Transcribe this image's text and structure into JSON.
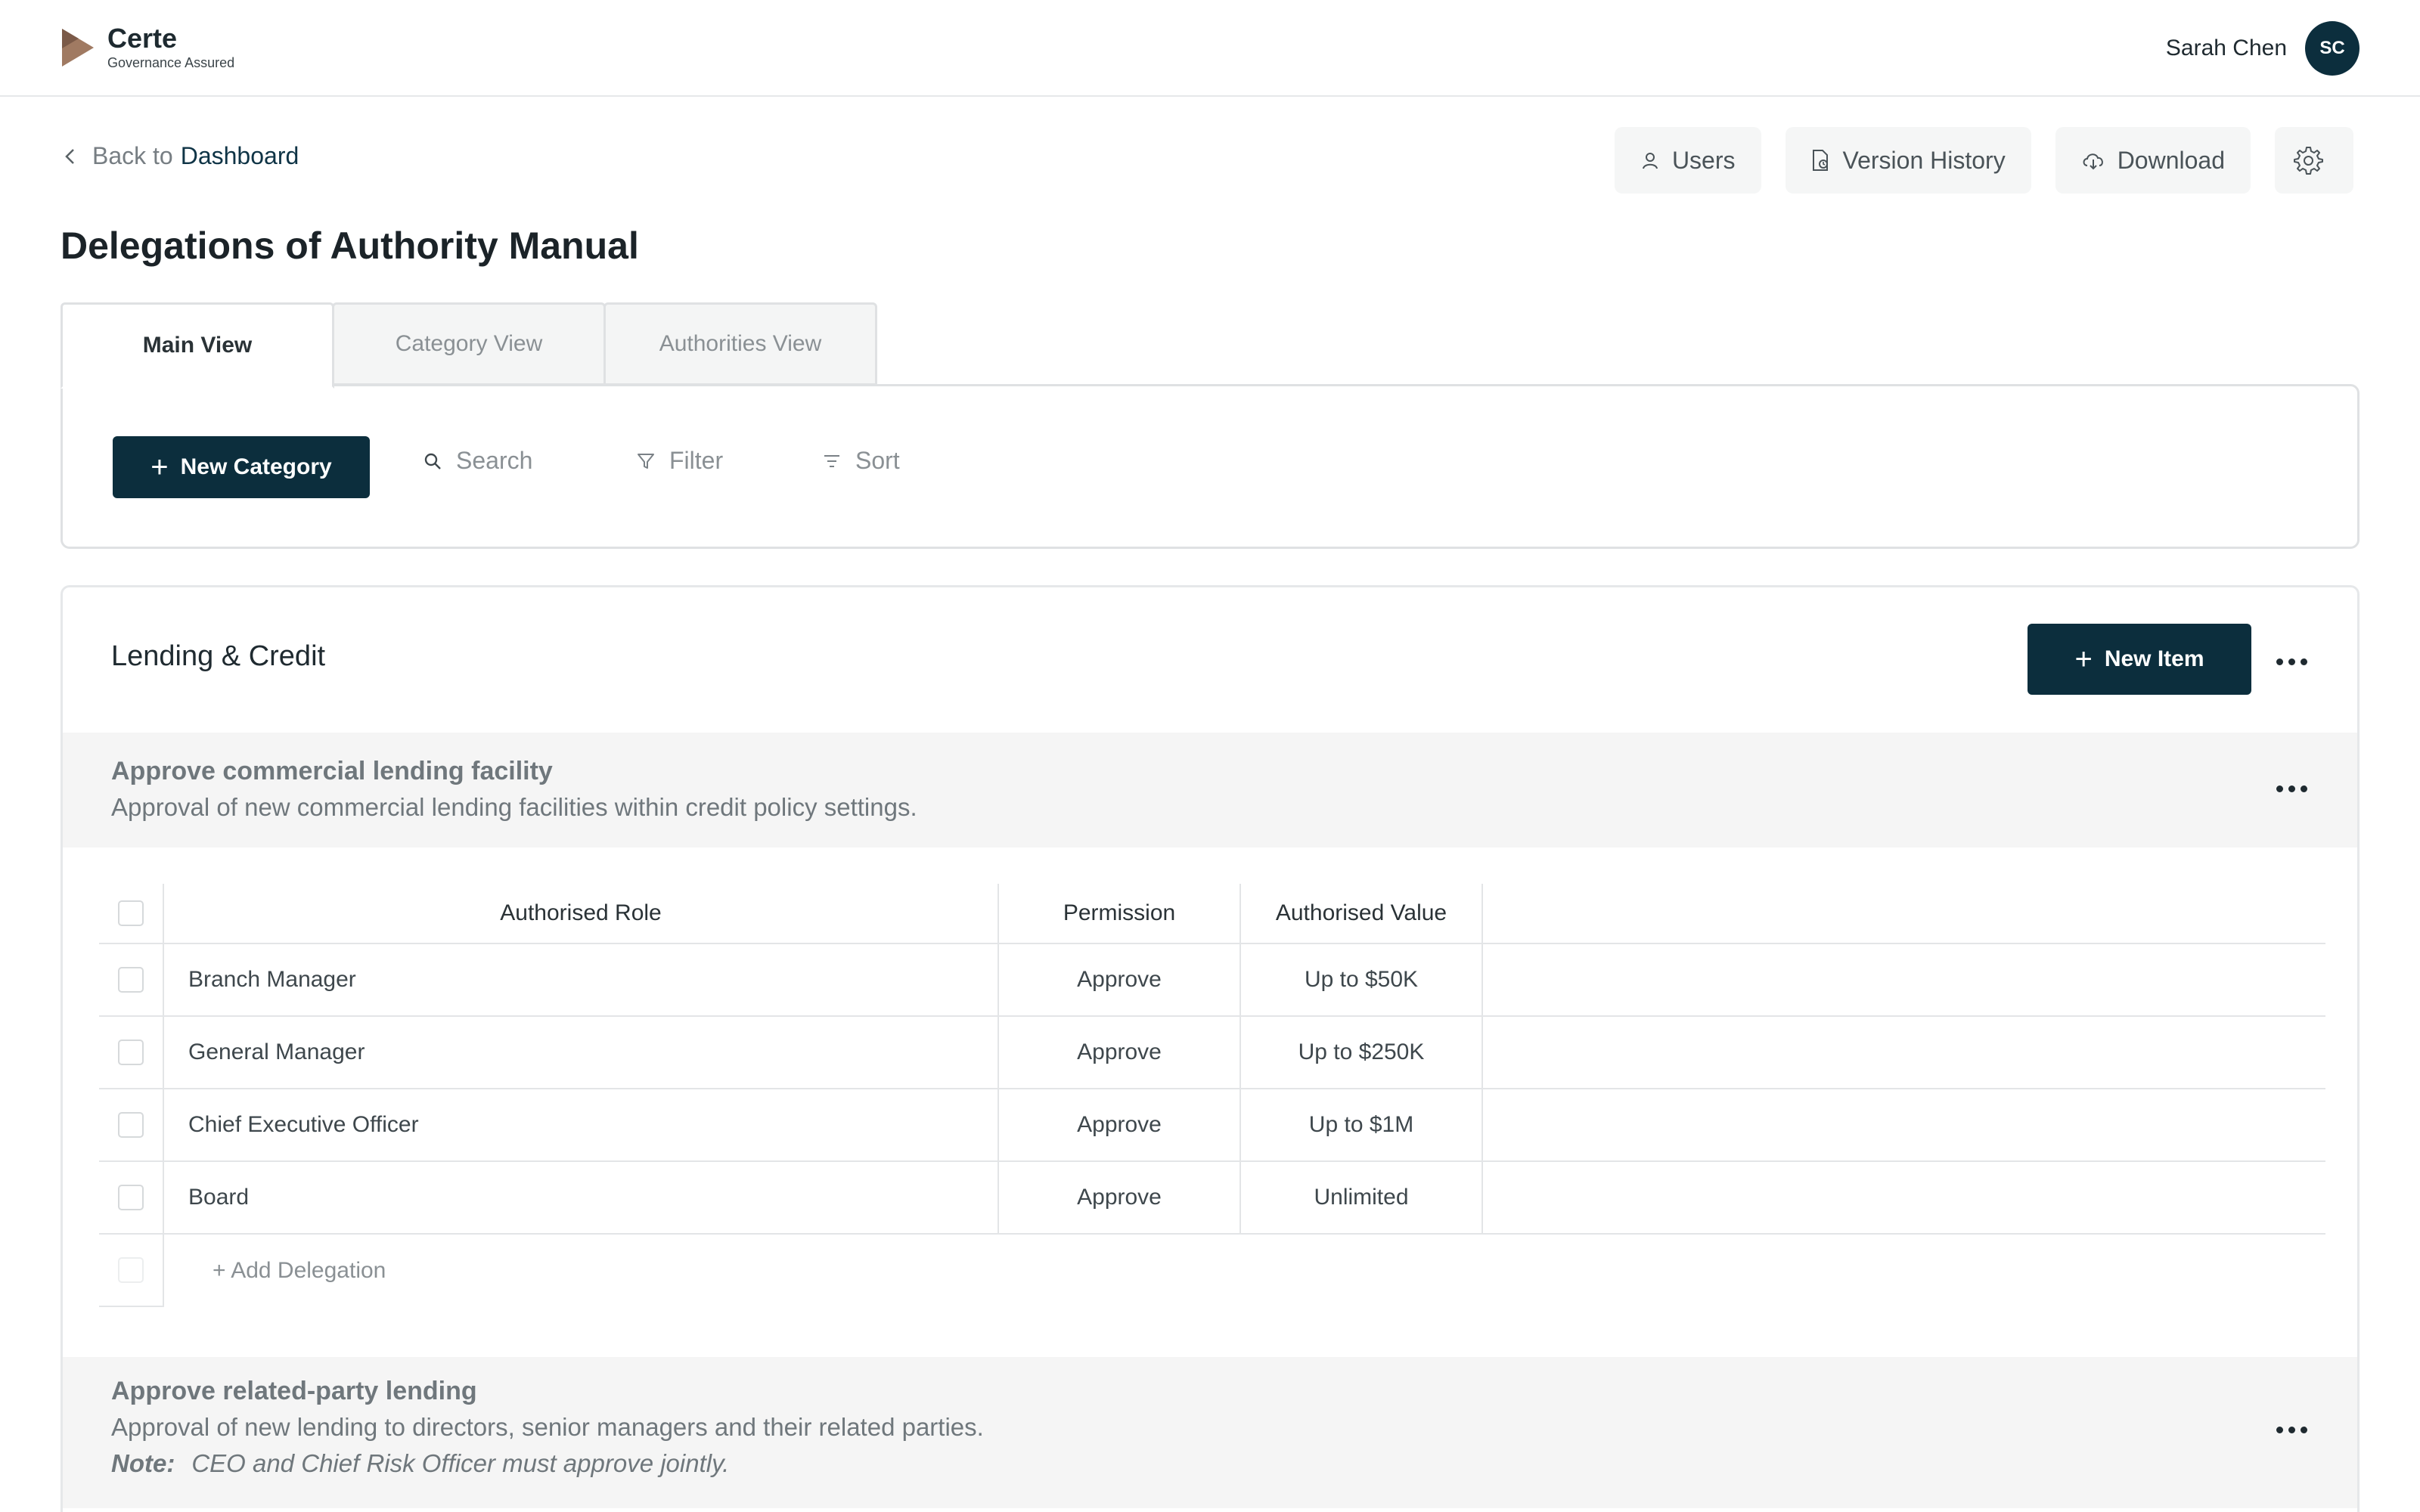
{
  "brand": {
    "name": "Certe",
    "tagline": "Governance Assured"
  },
  "user": {
    "name": "Sarah Chen",
    "initials": "SC"
  },
  "nav": {
    "back_prefix": "Back to",
    "back_target": "Dashboard"
  },
  "actions": {
    "users": "Users",
    "version_history": "Version History",
    "download": "Download"
  },
  "page": {
    "title": "Delegations of Authority Manual"
  },
  "tabs": [
    {
      "label": "Main View",
      "active": true
    },
    {
      "label": "Category View",
      "active": false
    },
    {
      "label": "Authorities View",
      "active": false
    }
  ],
  "toolbar": {
    "new_category": "New Category",
    "search": "Search",
    "filter": "Filter",
    "sort": "Sort"
  },
  "category": {
    "title": "Lending & Credit",
    "new_item": "New Item",
    "items": [
      {
        "title": "Approve commercial lending facility",
        "description": "Approval of new commercial lending facilities within credit policy settings."
      },
      {
        "title": "Approve related-party lending",
        "description": "Approval of new lending to directors, senior managers and their related parties.",
        "note_label": "Note:",
        "note": "CEO and Chief Risk Officer must approve jointly."
      }
    ]
  },
  "table": {
    "headers": {
      "role": "Authorised Role",
      "permission": "Permission",
      "value": "Authorised Value"
    },
    "rows": [
      {
        "role": "Branch Manager",
        "permission": "Approve",
        "value": "Up to $50K"
      },
      {
        "role": "General Manager",
        "permission": "Approve",
        "value": "Up to $250K"
      },
      {
        "role": "Chief Executive Officer",
        "permission": "Approve",
        "value": "Up to $1M"
      },
      {
        "role": "Board",
        "permission": "Approve",
        "value": "Unlimited"
      }
    ],
    "add_label": "+ Add Delegation"
  },
  "colors": {
    "primary": "#0c2e3d",
    "logo_accent": "#a07a62",
    "muted_bg": "#f5f5f5"
  }
}
